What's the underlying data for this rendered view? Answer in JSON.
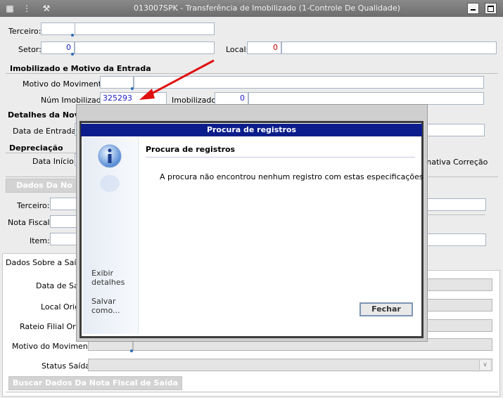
{
  "window": {
    "title": "013007SPK - Transferência de Imobilizado (1-Controle De Qualidade)"
  },
  "top": {
    "terceiro_label": "Terceiro:",
    "setor_label": "Setor:",
    "setor_value": "0",
    "local_label": "Local:",
    "local_value": "0"
  },
  "imobilizado": {
    "section_title": "Imobilizado e Motivo da Entrada",
    "motivo_label": "Motivo do Movimento:",
    "num_label": "Núm Imobilizado:",
    "num_value": "325293",
    "imob_label": "Imobilizado:",
    "imob_value": "0"
  },
  "detalhes": {
    "section_title": "Detalhes da Nova",
    "data_entrada_label": "Data de Entrada:"
  },
  "depreciacao": {
    "section_title": "Depreciação",
    "data_inicio_label": "Data Início:",
    "inativa_label": "Inativa Correção"
  },
  "nota": {
    "dados_button": "Dados Da No",
    "terceiro_label": "Terceiro:",
    "nota_label": "Nota Fiscal:",
    "item_label": "Item:"
  },
  "saida": {
    "tab_label": "Dados Sobre a Saída",
    "data_saida_label": "Data de Saíd",
    "local_origem_label": "Local Orige",
    "rateio_label": "Rateio Filial Orige",
    "motivo_label": "Motivo do Movimento:",
    "status_label": "Status Saída:",
    "buscar_button": "Buscar Dados Da Nota Fiscal de Saída"
  },
  "dialog": {
    "title": "Procura de registros",
    "heading": "Procura de registros",
    "message": "A procura não encontrou nenhum registro com estas especificações",
    "exibir": "Exibir detalhes",
    "salvar": "Salvar como...",
    "fechar": "Fechar"
  },
  "colors": {
    "titlebar": "#7a7a7a",
    "dialog_title": "#0a1d8a",
    "arrow": "#e01010",
    "number_text": "#1c1cc8"
  }
}
